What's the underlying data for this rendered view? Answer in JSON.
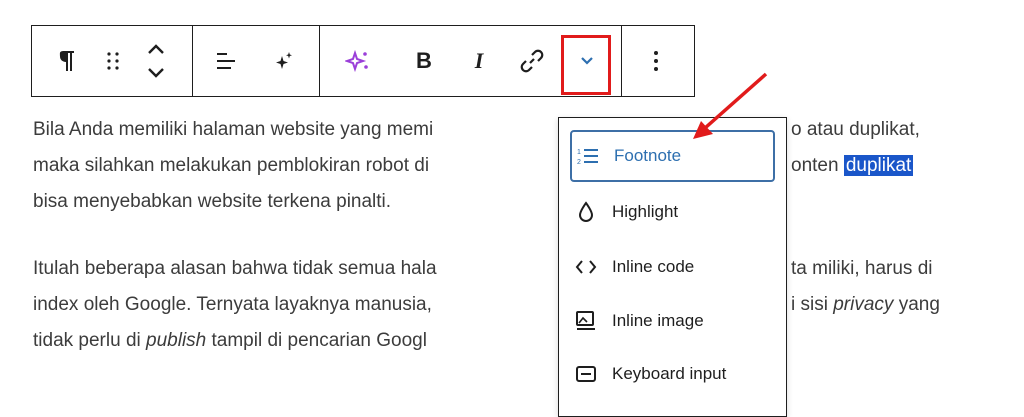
{
  "toolbar": {
    "buttons": [
      {
        "name": "paragraph-icon"
      },
      {
        "name": "drag-handle-icon"
      },
      {
        "name": "move-up-down-icon"
      },
      {
        "name": "align-icon"
      },
      {
        "name": "ai-sparkle-icon"
      },
      {
        "name": "ai-assist-icon"
      },
      {
        "name": "bold-icon",
        "label": "B"
      },
      {
        "name": "italic-icon",
        "label": "I"
      },
      {
        "name": "link-icon"
      },
      {
        "name": "more-rich-text-chevron-icon"
      },
      {
        "name": "options-kebab-icon"
      }
    ],
    "accent_color": "#9b3fd9",
    "highlight_color": "#e11b1b"
  },
  "content": {
    "p1": {
      "line1": "Bila Anda memiliki halaman website yang memi",
      "line1_tail": "o atau duplikat,",
      "line2": "maka silahkan melakukan pemblokiran robot di",
      "line2_tail": "onten ",
      "line2_selected": "duplikat",
      "line3": "bisa menyebabkan website terkena pinalti."
    },
    "p2": {
      "line1": "Itulah beberapa alasan bahwa tidak semua hala",
      "line1_tail": "ta miliki, harus di",
      "line2": "index oleh Google. Ternyata layaknya manusia, ",
      "line2_tail_pre": "i sisi ",
      "line2_tail_em": "privacy",
      "line2_tail_post": " yang",
      "line3_pre": "tidak perlu di ",
      "line3_em": "publish",
      "line3_post": " tampil di pencarian Googl"
    },
    "selection_color": "#1a56c9"
  },
  "dropdown": {
    "items": [
      {
        "label": "Footnote",
        "icon": "footnote-icon",
        "active": true
      },
      {
        "label": "Highlight",
        "icon": "highlight-drop-icon",
        "active": false
      },
      {
        "label": "Inline code",
        "icon": "code-icon",
        "active": false
      },
      {
        "label": "Inline image",
        "icon": "image-icon",
        "active": false
      },
      {
        "label": "Keyboard input",
        "icon": "keyboard-icon",
        "active": false
      }
    ],
    "active_color": "#2d6fb0"
  }
}
